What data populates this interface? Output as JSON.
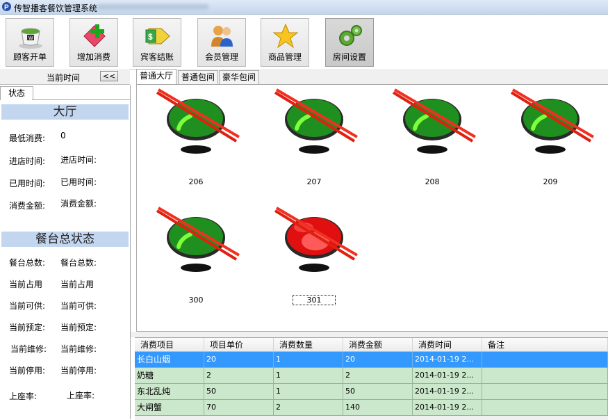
{
  "window": {
    "title": "传智播客餐饮管理系统"
  },
  "toolbar": [
    {
      "label": "顾客开单",
      "icon": "coffee-cup-icon"
    },
    {
      "label": "增加消费",
      "icon": "add-diamond-icon"
    },
    {
      "label": "宾客结账",
      "icon": "money-arrow-icon"
    },
    {
      "label": "会员管理",
      "icon": "members-icon"
    },
    {
      "label": "商品管理",
      "icon": "star-icon"
    },
    {
      "label": "房间设置",
      "icon": "gears-icon"
    }
  ],
  "left_panel": {
    "header": "当前时间",
    "collapse_label": "<<",
    "tab": "状态",
    "hall": {
      "title": "大厅",
      "fields": [
        {
          "label": "最低消费:",
          "value": "0"
        },
        {
          "label": "进店时间:",
          "value": "进店时间:"
        },
        {
          "label": "已用时间:",
          "value": "已用时间:"
        },
        {
          "label": "消费金额:",
          "value": "消费金额:"
        }
      ]
    },
    "summary": {
      "title": "餐台总状态",
      "fields": [
        {
          "label": "餐台总数:",
          "value": "餐台总数:"
        },
        {
          "label": "当前占用",
          "value": "当前占用"
        },
        {
          "label": "当前可供:",
          "value": "当前可供:"
        },
        {
          "label": "当前预定:",
          "value": "当前预定:"
        },
        {
          "label": "当前维修:",
          "value": "当前维修:"
        },
        {
          "label": "当前停用:",
          "value": "当前停用:"
        },
        {
          "label": "上座率:",
          "value": "上座率:"
        }
      ]
    }
  },
  "room_tabs": [
    "普通大厅",
    "普通包间",
    "豪华包间"
  ],
  "tables": [
    {
      "label": "206",
      "status": "free"
    },
    {
      "label": "207",
      "status": "free"
    },
    {
      "label": "208",
      "status": "free"
    },
    {
      "label": "209",
      "status": "free"
    },
    {
      "label": "300",
      "status": "free"
    },
    {
      "label": "301",
      "status": "occupied"
    }
  ],
  "status_colors": {
    "free": "#1f8f1f",
    "occupied": "#e01010",
    "selected_row": "#3399ff",
    "row": "#cce8cc"
  },
  "consumption": {
    "columns": [
      "消费项目",
      "项目单价",
      "消费数量",
      "消费金额",
      "消费时间",
      "备注"
    ],
    "rows": [
      [
        "长白山烟",
        "20",
        "1",
        "20",
        "2014-01-19 2...",
        ""
      ],
      [
        "奶糖",
        "2",
        "1",
        "2",
        "2014-01-19 2...",
        ""
      ],
      [
        "东北乱炖",
        "50",
        "1",
        "50",
        "2014-01-19 2...",
        ""
      ],
      [
        "大闸蟹",
        "70",
        "2",
        "140",
        "2014-01-19 2...",
        ""
      ]
    ]
  }
}
